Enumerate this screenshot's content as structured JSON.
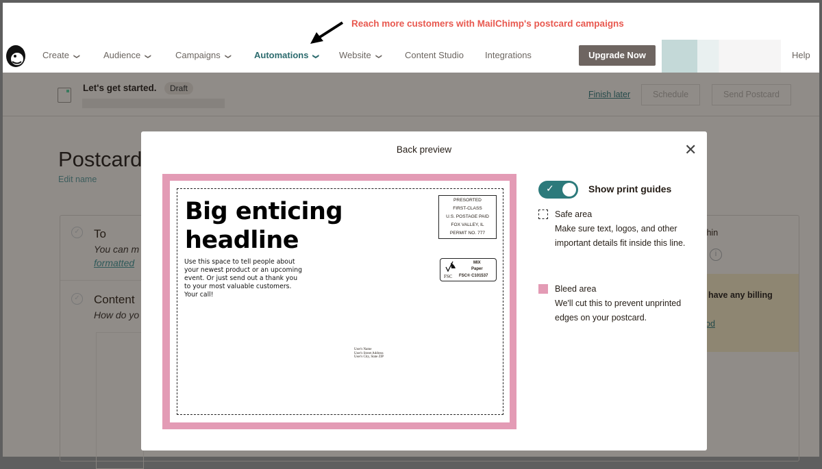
{
  "annotation": "Reach more customers with MailChimp's postcard campaigns",
  "nav": {
    "items": [
      {
        "label": "Create",
        "chev": true,
        "active": false
      },
      {
        "label": "Audience",
        "chev": true,
        "active": false
      },
      {
        "label": "Campaigns",
        "chev": true,
        "active": false
      },
      {
        "label": "Automations",
        "chev": true,
        "active": true
      },
      {
        "label": "Website",
        "chev": true,
        "active": false
      },
      {
        "label": "Content Studio",
        "chev": false,
        "active": false
      },
      {
        "label": "Integrations",
        "chev": false,
        "active": false
      }
    ],
    "upgrade": "Upgrade Now",
    "help": "Help"
  },
  "subbar": {
    "title": "Let's get started.",
    "badge": "Draft",
    "finish_later": "Finish later",
    "schedule": "Schedule",
    "send": "Send Postcard"
  },
  "page": {
    "title": "Postcard",
    "edit_name": "Edit name",
    "to_title": "To",
    "to_desc": "You can m",
    "to_link": "formatted",
    "content_title": "Content",
    "content_desc": "How do yo",
    "right_frag": "thin",
    "billing_frag": "have any billing",
    "billing_link": "od"
  },
  "modal": {
    "title": "Back preview",
    "postcard": {
      "headline": "Big enticing headline",
      "body": "Use this space to tell people about your newest product or an upcoming event. Or just send out a thank you to your most valuable customers. Your call!",
      "postage": [
        "PRESORTED",
        "FIRST-CLASS",
        "U.S. POSTAGE PAID",
        "FOX VALLEY, IL",
        "PERMIT NO. 777"
      ],
      "fsc": {
        "mix": "MIX",
        "paper": "Paper",
        "logo": "FSC",
        "code": "FSC® C101537"
      },
      "address": [
        "User's Name",
        "User's Street Address",
        "User's City, State ZIP"
      ]
    },
    "toggle": {
      "label": "Show print guides",
      "on": true
    },
    "safe": {
      "title": "Safe area",
      "desc": "Make sure text, logos, and other important details fit inside this line."
    },
    "bleed": {
      "title": "Bleed area",
      "desc": "We'll cut this to prevent unprinted edges on your postcard.",
      "color": "#e39bb5"
    }
  },
  "colors": {
    "accent": "#2c7a7b",
    "promo": "#e8584f"
  }
}
